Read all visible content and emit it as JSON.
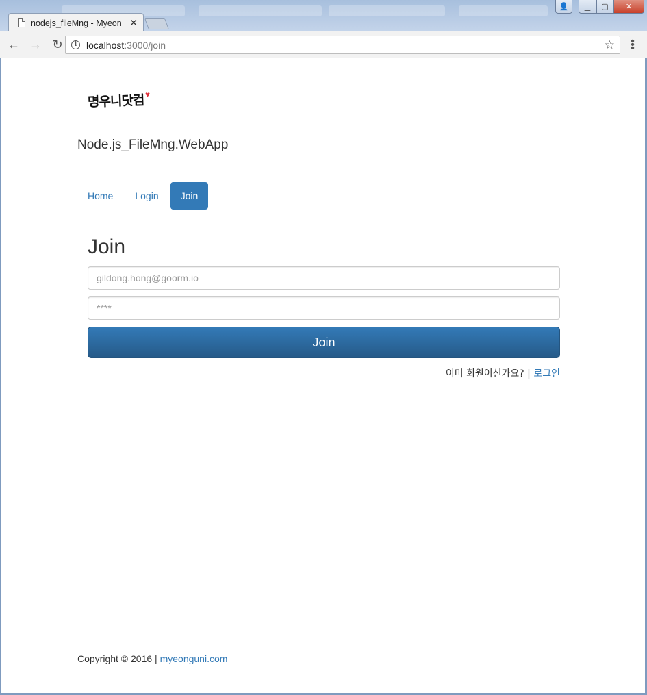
{
  "browser": {
    "tab_title": "nodejs_fileMng - Myeon",
    "tab_close": "✕",
    "url_host": "localhost",
    "url_path": ":3000/join",
    "info_glyph": "i",
    "back_glyph": "←",
    "forward_glyph": "→",
    "reload_glyph": "↻",
    "star_glyph": "☆",
    "menu_glyph": "⋮",
    "window_controls": {
      "user": "👤",
      "minimize": "▁",
      "maximize": "▢",
      "close": "✕"
    }
  },
  "header": {
    "logo_text": "명우니닷컴",
    "logo_heart": "♥",
    "app_title": "Node.js_FileMng.WebApp"
  },
  "nav": {
    "items": [
      {
        "label": "Home",
        "active": false
      },
      {
        "label": "Login",
        "active": false
      },
      {
        "label": "Join",
        "active": true
      }
    ]
  },
  "form": {
    "title": "Join",
    "email_placeholder": "gildong.hong@goorm.io",
    "password_placeholder": "****",
    "submit_label": "Join",
    "already_member_text": "이미 회원이신가요? |",
    "login_link_label": "로그인"
  },
  "footer": {
    "copyright": "Copyright © 2016 |",
    "link_label": "myeonguni.com"
  },
  "colors": {
    "accent": "#337ab7",
    "heart": "#e0303a"
  }
}
